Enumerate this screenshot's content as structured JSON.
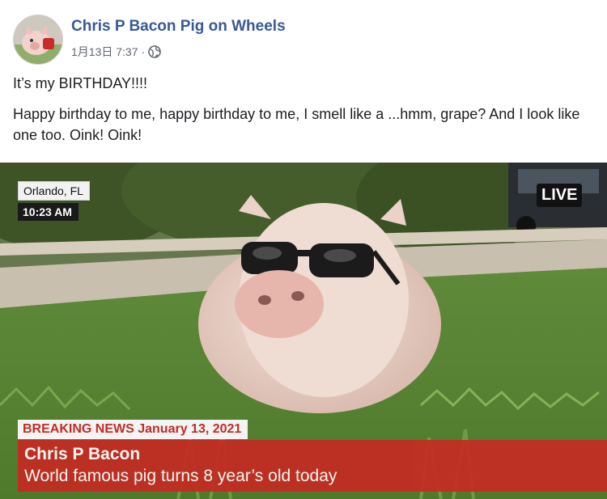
{
  "post": {
    "author": "Chris P Bacon Pig on Wheels",
    "date": "1月13日 7:37",
    "separator": "·",
    "privacy_icon": "globe-icon",
    "text_line1": "It’s my BIRTHDAY!!!!",
    "text_line2": "Happy birthday to me, happy birthday to me, I smell like a ...hmm, grape? And I look like one too. Oink! Oink!"
  },
  "media": {
    "location": "Orlando, FL",
    "time": "10:23 AM",
    "live": "LIVE",
    "breaking_label": "BREAKING NEWS",
    "breaking_date": "January 13, 2021",
    "headline": "Chris P Bacon",
    "subheadline": "World famous pig turns 8 year’s old today"
  },
  "colors": {
    "author_link": "#385898",
    "breaking_red": "#c52b23",
    "grass": "#6c8f4a"
  }
}
